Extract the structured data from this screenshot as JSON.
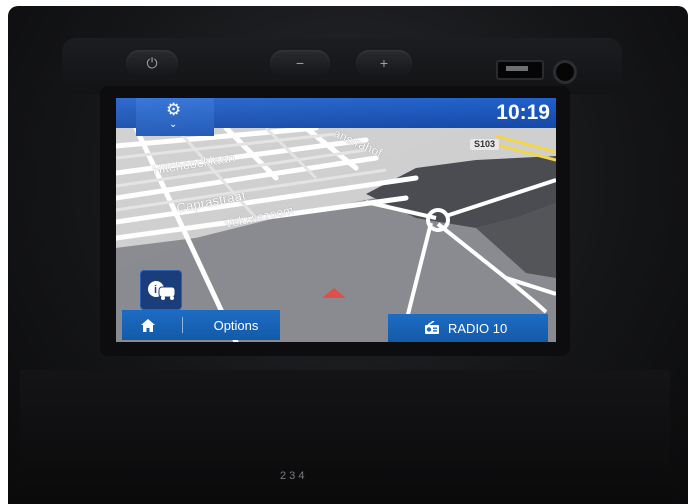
{
  "statusbar": {
    "time": "10:19",
    "settings_icon": "gear-icon",
    "expand_icon": "chevron-down-icon"
  },
  "map": {
    "streets": [
      "Hitchcocklaan",
      "Caprastraat",
      "Veluwezoom",
      "anstrahof"
    ],
    "road_badge": "S103",
    "position_marker": "navigation-arrow"
  },
  "bottombar": {
    "home_icon": "home-icon",
    "options_label": "Options",
    "source_icon": "radio-icon",
    "source_label": "RADIO 10"
  },
  "hardware": {
    "power_icon": "power-icon",
    "volume_down": "−",
    "volume_up": "+"
  },
  "gear_indicator": "2  3  4"
}
